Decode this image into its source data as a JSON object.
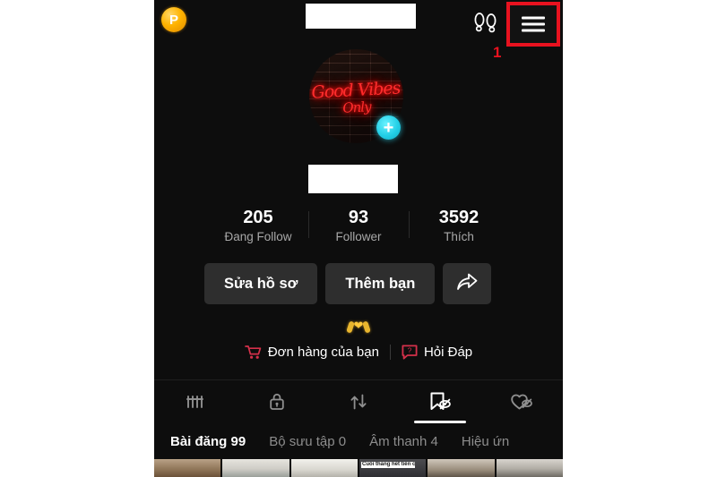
{
  "app": {
    "platform": "TikTok profile page (Vietnamese)",
    "background_color": "#0d0d0d",
    "accent_cyan": "#23cfe6",
    "accent_red": "#e8121f",
    "accent_gold": "#ffb300",
    "shop_red": "#d4304a"
  },
  "topbar": {
    "coin_label": "P",
    "coin_icon": "coin-p-icon",
    "username_redacted": "",
    "footprints_icon": "footprints-icon",
    "menu_icon": "hamburger-menu-icon",
    "annotation_number": "1"
  },
  "profile": {
    "avatar_icon": "profile-avatar",
    "avatar_neon_line1": "Good Vibes",
    "avatar_neon_line2": "Only",
    "add_icon": "plus-badge-icon",
    "display_name_redacted": ""
  },
  "stats": [
    {
      "value": "205",
      "label": "Đang Follow"
    },
    {
      "value": "93",
      "label": "Follower"
    },
    {
      "value": "3592",
      "label": "Thích"
    }
  ],
  "actions": {
    "edit_profile": "Sửa hồ sơ",
    "add_friend": "Thêm bạn",
    "share_icon": "share-arrow-icon"
  },
  "bio": {
    "emoji_icon": "heart-hands-icon"
  },
  "links": [
    {
      "label": "Đơn hàng của bạn",
      "icon": "shopping-cart-icon"
    },
    {
      "label": "Hỏi Đáp",
      "icon": "question-bubble-icon"
    }
  ],
  "tabs": [
    {
      "icon": "grid-posts-icon",
      "active": false
    },
    {
      "icon": "lock-private-icon",
      "active": false
    },
    {
      "icon": "repost-arrows-icon",
      "active": false
    },
    {
      "icon": "bookmark-hidden-icon",
      "active": true
    },
    {
      "icon": "heart-hidden-icon",
      "active": false
    }
  ],
  "subtabs": [
    {
      "label": "Bài đăng 99",
      "active": true
    },
    {
      "label": "Bộ sưu tập 0",
      "active": false
    },
    {
      "label": "Âm thanh 4",
      "active": false
    },
    {
      "label": "Hiệu ứn",
      "active": false
    }
  ],
  "thumbnails": [
    {
      "caption": ""
    },
    {
      "caption": ""
    },
    {
      "caption": ""
    },
    {
      "caption": "Cuối tháng hết tiền cũng phải"
    },
    {
      "caption": ""
    },
    {
      "caption": ""
    }
  ]
}
